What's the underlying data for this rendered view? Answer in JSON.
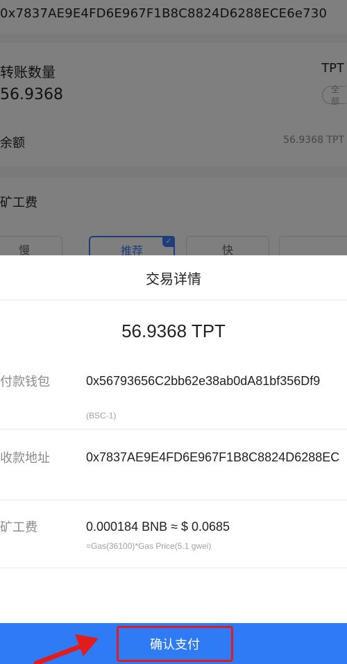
{
  "background": {
    "to_address_full": "0x7837AE9E4FD6E967F1B8C8824D6288ECE6e730",
    "amount_label": "转账数量",
    "token_unit": "TPT",
    "amount_value": "56.9368",
    "all_button": "全部",
    "balance_label": "余额",
    "balance_value": "56.9368 TPT",
    "fee_label": "矿工费",
    "speed_options": [
      "慢",
      "推荐",
      "快",
      ""
    ]
  },
  "sheet": {
    "title": "交易详情",
    "amount": "56.9368 TPT",
    "rows": [
      {
        "label": "付款钱包",
        "value": "0x56793656C2bb62e38ab0dA81bf356Df9",
        "sub": "(BSC-1)"
      },
      {
        "label": "收款地址",
        "value": "0x7837AE9E4FD6E967F1B8C8824D6288EC",
        "sub": ""
      },
      {
        "label": "矿工费",
        "value": "0.000184 BNB ≈ $ 0.0685",
        "sub": "=Gas(36100)*Gas Price(5.1 gwei)"
      }
    ]
  },
  "confirm_button": "确认支付",
  "colors": {
    "accent": "#2f7bf6",
    "highlight": "#e21b1b",
    "overlay": "rgba(0,0,0,0.5)"
  }
}
